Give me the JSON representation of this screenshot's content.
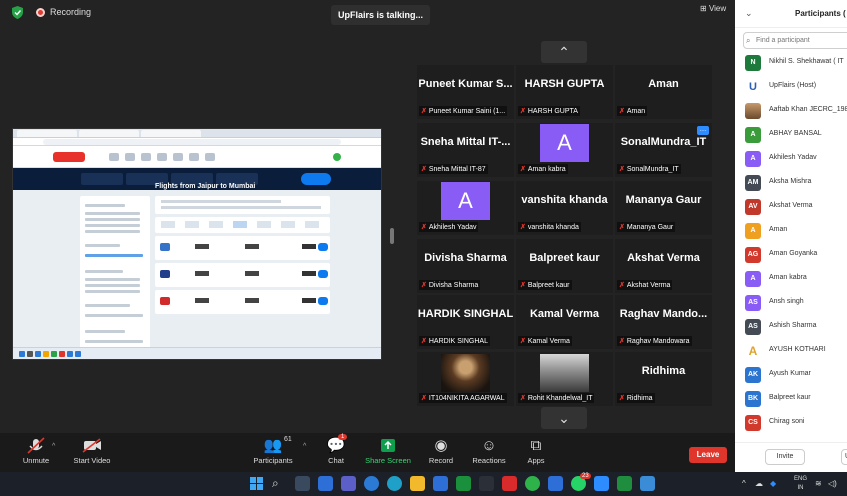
{
  "top": {
    "recording_label": "Recording",
    "talking_indicator": "UpFlairs is talking...",
    "view_label": "View",
    "colors": {
      "recording": "#e03c31",
      "wall": "#6b4070"
    }
  },
  "shared_screen": {
    "page_title": "Flights from Jaipur to Mumbai"
  },
  "gallery": {
    "tiles": [
      {
        "name": "Puneet Kumar S...",
        "label": "Puneet Kumar Saini (1...",
        "type": "name"
      },
      {
        "name": "HARSH GUPTA",
        "label": "HARSH GUPTA",
        "type": "name"
      },
      {
        "name": "Aman",
        "label": "Aman",
        "type": "name"
      },
      {
        "name": "Sneha Mittal IT-...",
        "label": "Sneha Mittal IT-87",
        "type": "name"
      },
      {
        "name": "A",
        "label": "Aman kabra",
        "type": "avatar",
        "color": "#8a5cf6"
      },
      {
        "name": "SonalMundra_IT",
        "label": "SonalMundra_IT",
        "type": "name",
        "more": "…"
      },
      {
        "name": "A",
        "label": "Akhilesh Yadav",
        "type": "avatar",
        "color": "#8a5cf6"
      },
      {
        "name": "vanshita khanda",
        "label": "vanshita khanda",
        "type": "name"
      },
      {
        "name": "Mananya Gaur",
        "label": "Mananya Gaur",
        "type": "name"
      },
      {
        "name": "Divisha Sharma",
        "label": "Divisha Sharma",
        "type": "name"
      },
      {
        "name": "Balpreet kaur",
        "label": "Balpreet kaur",
        "type": "name"
      },
      {
        "name": "Akshat Verma",
        "label": "Akshat Verma",
        "type": "name"
      },
      {
        "name": "HARDIK SINGHAL",
        "label": "HARDIK SINGHAL",
        "type": "name"
      },
      {
        "name": "Kamal Verma",
        "label": "Kamal Verma",
        "type": "name"
      },
      {
        "name": "Raghav Mando...",
        "label": "Raghav Mandowara",
        "type": "name"
      },
      {
        "name": "",
        "label": "IT104NIKITA AGARWAL",
        "type": "photo"
      },
      {
        "name": "",
        "label": "Rohit Khandelwal_IT",
        "type": "photo"
      },
      {
        "name": "Ridhima",
        "label": "Ridhima",
        "type": "name"
      }
    ],
    "arrow_up": "⌃",
    "arrow_down": "⌄"
  },
  "participants_panel": {
    "title": "Participants (",
    "search_placeholder": "Find a participant",
    "invite_label": "Invite",
    "footer_more": "U",
    "items": [
      {
        "initials": "N",
        "name": "Nikhil S. Shekhawat ( IT",
        "color": "#1e7a3c"
      },
      {
        "initials": "U",
        "name": "UpFlairs (Host)",
        "color": "#2b5fb4",
        "icon": "upflairs-logo-icon"
      },
      {
        "initials": "",
        "name": "Aaftab Khan JECRC_198",
        "color": "#7a5a3a",
        "icon": "photo-avatar-icon"
      },
      {
        "initials": "A",
        "name": "ABHAY BANSAL",
        "color": "#3a9b3a"
      },
      {
        "initials": "A",
        "name": "Akhilesh Yadav",
        "color": "#8a5cf6"
      },
      {
        "initials": "AM",
        "name": "Aksha Mishra",
        "color": "#444b55"
      },
      {
        "initials": "AV",
        "name": "Akshat Verma",
        "color": "#c0392b"
      },
      {
        "initials": "A",
        "name": "Aman",
        "color": "#f0a020"
      },
      {
        "initials": "AG",
        "name": "Aman Goyanka",
        "color": "#d0392b"
      },
      {
        "initials": "A",
        "name": "Aman kabra",
        "color": "#8a5cf6"
      },
      {
        "initials": "AS",
        "name": "Ansh singh",
        "color": "#8a5cf6"
      },
      {
        "initials": "AS",
        "name": "Ashish Sharma",
        "color": "#444b55"
      },
      {
        "initials": "A",
        "name": "AYUSH KOTHARI",
        "color": "#e0a32b",
        "icon": "letter-a-logo-icon"
      },
      {
        "initials": "AK",
        "name": "Ayush Kumar",
        "color": "#2b74d0"
      },
      {
        "initials": "BK",
        "name": "Balpreet kaur",
        "color": "#2b74d0"
      },
      {
        "initials": "CS",
        "name": "Chirag soni",
        "color": "#d0392b"
      }
    ]
  },
  "toolbar": {
    "unmute": "Unmute",
    "start_video": "Start Video",
    "participants": "Participants",
    "participant_count": "61",
    "chat": "Chat",
    "chat_badge": "1",
    "share_screen": "Share Screen",
    "record": "Record",
    "reactions": "Reactions",
    "apps": "Apps",
    "leave": "Leave",
    "colors": {
      "share": "#0e9f4e",
      "leave": "#e0352b"
    }
  },
  "taskbar": {
    "lang_line1": "ENG",
    "lang_line2": "IN",
    "whatsapp_badge": "23"
  }
}
